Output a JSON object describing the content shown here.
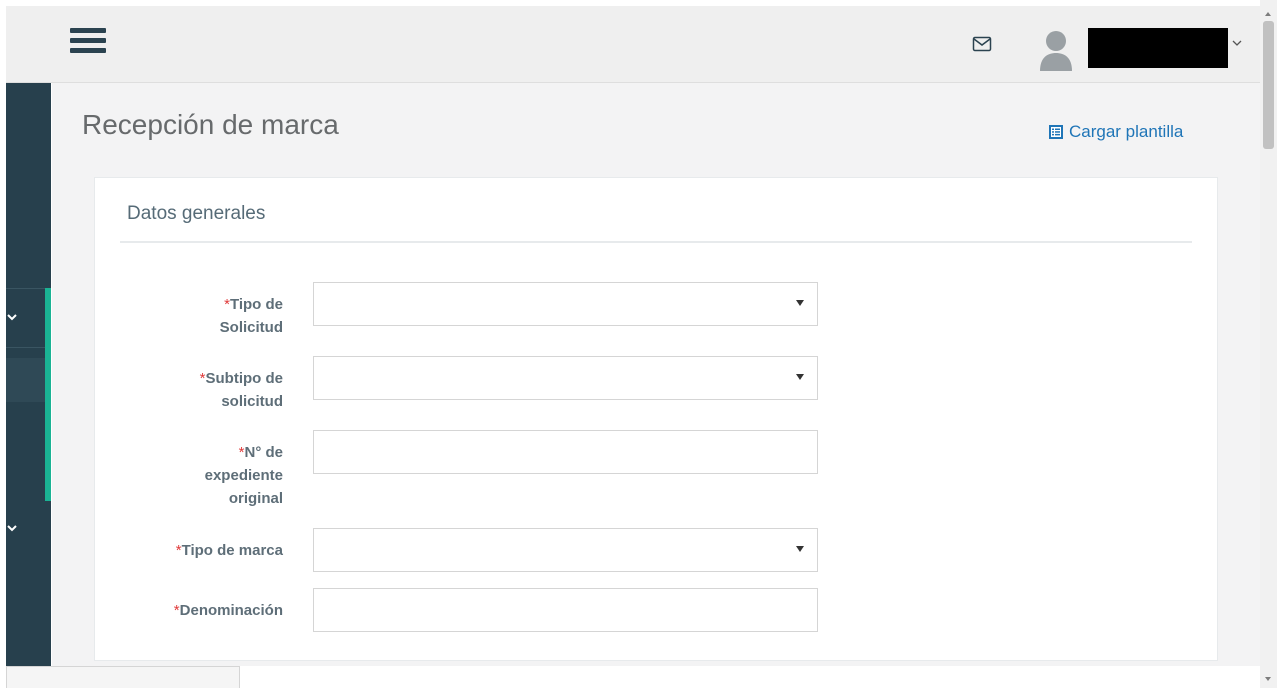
{
  "header": {
    "menu_icon": "hamburger-icon",
    "mail_icon": "envelope-icon",
    "avatar_icon": "user-silhouette-icon",
    "user_name_redacted": true,
    "user_menu_icon": "chevron-down-icon"
  },
  "sidebar": {
    "accent_color": "#1ab394",
    "background_color": "#27404d",
    "items": [
      {
        "icon": "chevron-down-icon",
        "expanded": true
      },
      {
        "icon": "chevron-down-icon",
        "expanded": false
      }
    ]
  },
  "page": {
    "title": "Recepción de marca",
    "load_template_label": "Cargar plantilla",
    "load_template_icon": "list-document-icon"
  },
  "form": {
    "section_title": "Datos generales",
    "required_marker": "*",
    "fields": [
      {
        "label_lines": [
          "Tipo de",
          "Solicitud"
        ],
        "type": "select",
        "value": ""
      },
      {
        "label_lines": [
          "Subtipo de",
          "solicitud"
        ],
        "type": "select",
        "value": ""
      },
      {
        "label_lines": [
          "N° de",
          "expediente",
          "original"
        ],
        "type": "text",
        "value": ""
      },
      {
        "label_lines": [
          "Tipo de marca"
        ],
        "type": "select",
        "value": ""
      },
      {
        "label_lines": [
          "Denominación"
        ],
        "type": "text",
        "value": ""
      }
    ]
  }
}
